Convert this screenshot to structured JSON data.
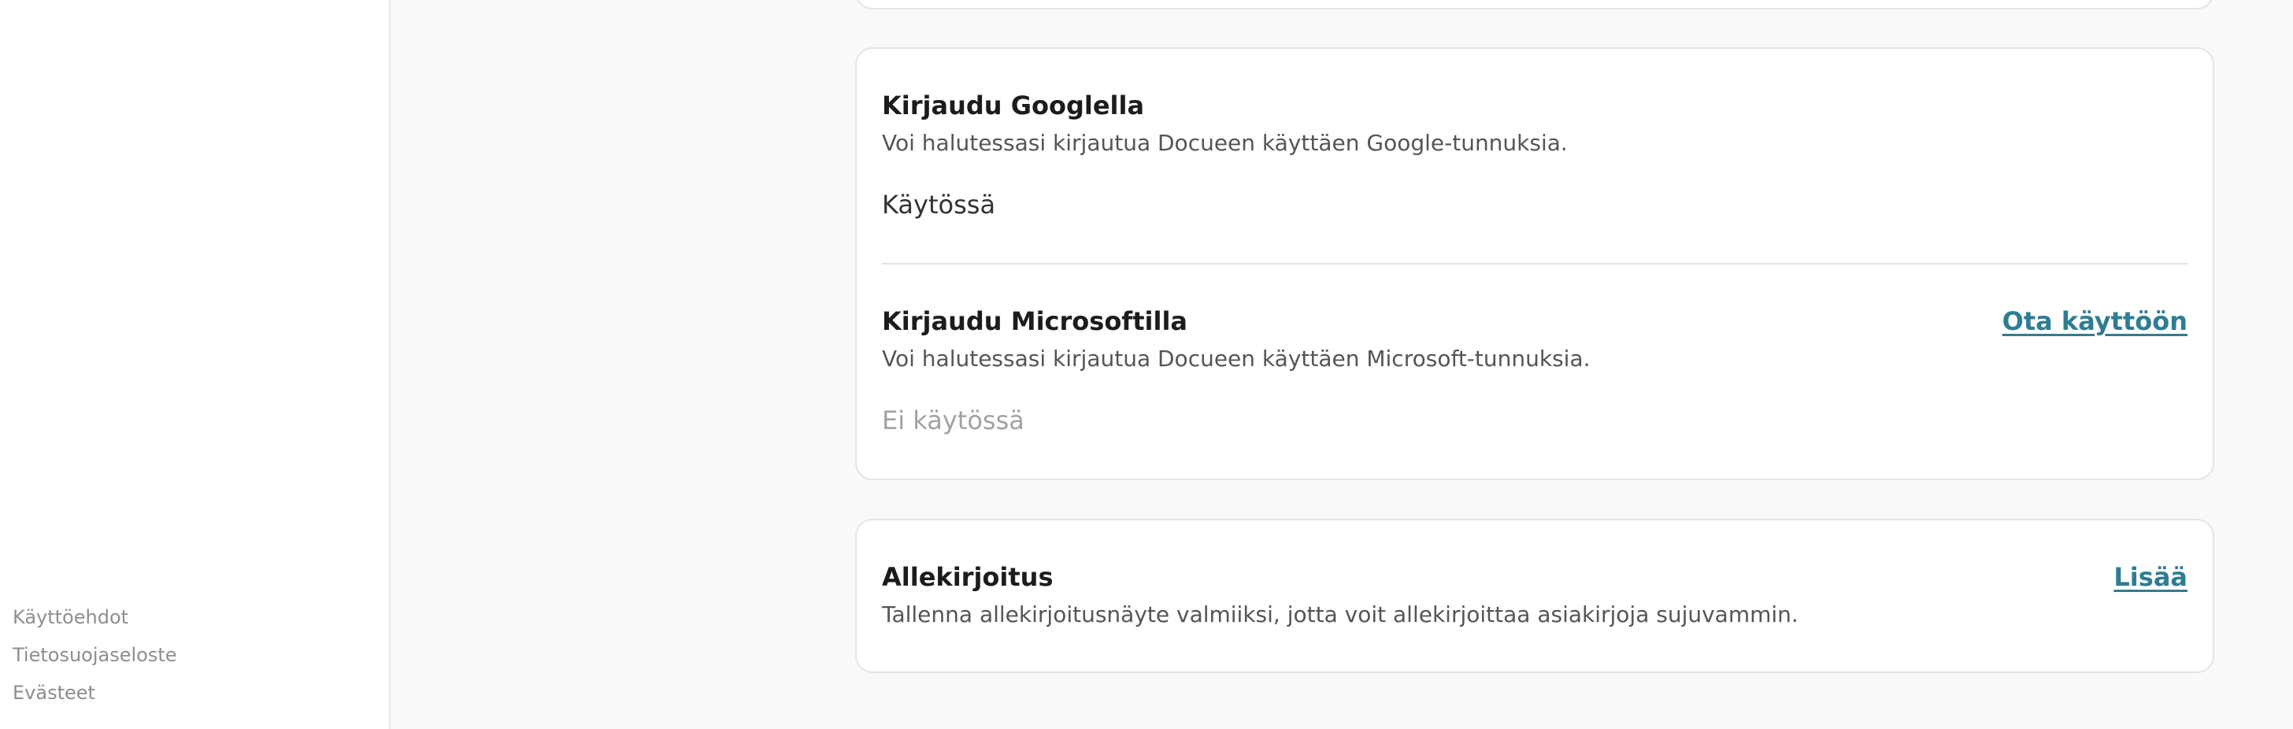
{
  "sidebar": {
    "footer_links": [
      "Käyttöehdot",
      "Tietosuojaseloste",
      "Evästeet"
    ]
  },
  "login": {
    "google": {
      "title": "Kirjaudu Googlella",
      "description": "Voi halutessasi kirjautua Docueen käyttäen Google-tunnuksia.",
      "status": "Käytössä"
    },
    "microsoft": {
      "title": "Kirjaudu Microsoftilla",
      "description": "Voi halutessasi kirjautua Docueen käyttäen Microsoft-tunnuksia.",
      "status": "Ei käytössä",
      "action_label": "Ota käyttöön"
    }
  },
  "signature": {
    "title": "Allekirjoitus",
    "description": "Tallenna allekirjoitusnäyte valmiiksi, jotta voit allekirjoittaa asiakirjoja sujuvammin.",
    "action_label": "Lisää"
  },
  "colors": {
    "link": "#2f7d92",
    "border": "#e4e4e4",
    "background": "#f9f9f8"
  }
}
